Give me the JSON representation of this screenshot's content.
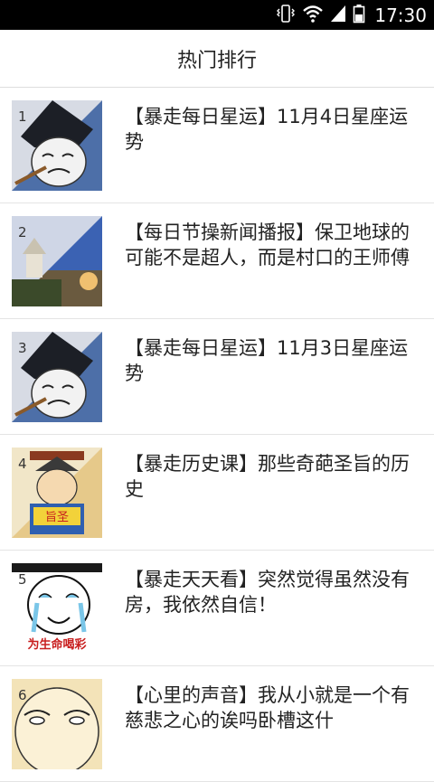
{
  "status_bar": {
    "time": "17:30",
    "icons": [
      "vibrate-icon",
      "wifi-icon",
      "signal-icon",
      "battery-icon"
    ]
  },
  "header": {
    "title": "热门排行"
  },
  "articles": [
    {
      "rank": "1",
      "title": "【暴走每日星运】11月4日星座运势"
    },
    {
      "rank": "2",
      "title": "【每日节操新闻播报】保卫地球的可能不是超人，而是村口的王师傅"
    },
    {
      "rank": "3",
      "title": "【暴走每日星运】11月3日星座运势"
    },
    {
      "rank": "4",
      "title": "【暴走历史课】那些奇葩圣旨的历史"
    },
    {
      "rank": "5",
      "title": "【暴走天天看】突然觉得虽然没有房，我依然自信！"
    },
    {
      "rank": "6",
      "title": "【心里的声音】我从小就是一个有慈悲之心的诶吗卧槽这什"
    }
  ],
  "thumb_text": {
    "edict": "旨圣",
    "cheer": "为生命喝彩"
  },
  "colors": {
    "status_bar_bg": "#000000",
    "divider": "#e4e4e4",
    "text": "#222222"
  }
}
